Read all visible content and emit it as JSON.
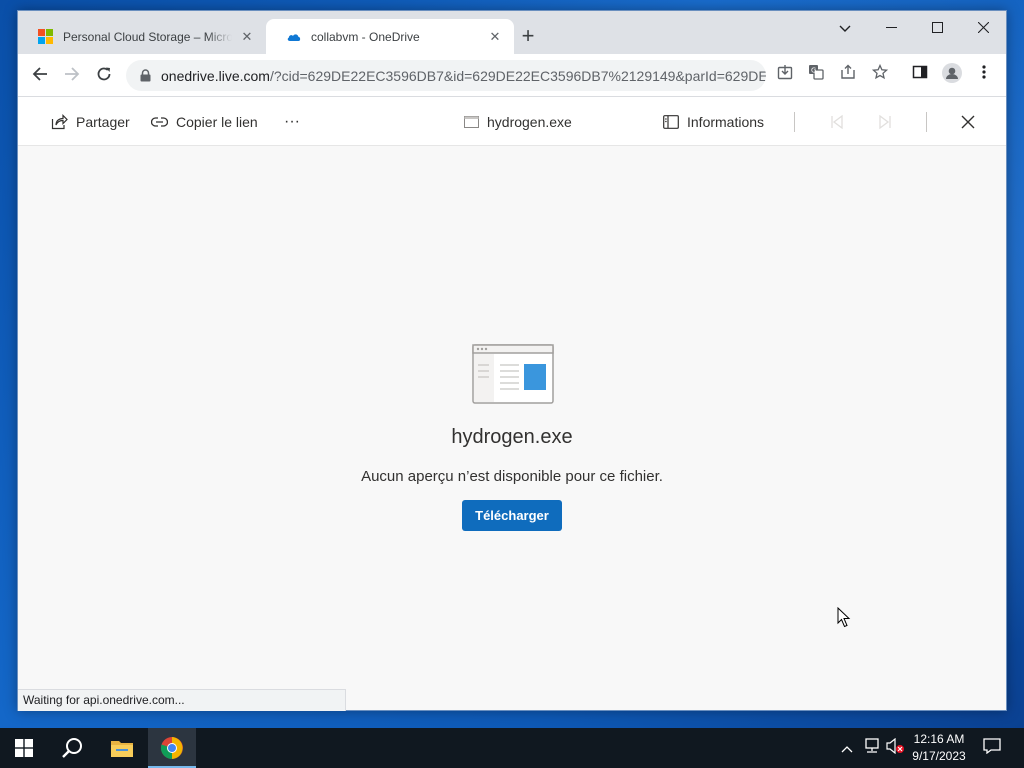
{
  "tabs": [
    {
      "title": "Personal Cloud Storage – Microsoft OneDrive",
      "active": false
    },
    {
      "title": "collabvm - OneDrive",
      "active": true
    }
  ],
  "omnibox": {
    "host": "onedrive.live.com",
    "rest": "/?cid=629DE22EC3596DB7&id=629DE22EC3596DB7%2129149&parId=629DE..."
  },
  "viewer": {
    "share_label": "Partager",
    "copy_link_label": "Copier le lien",
    "more_label": "···",
    "file_name": "hydrogen.exe",
    "info_label": "Informations"
  },
  "content": {
    "file_name": "hydrogen.exe",
    "message": "Aucun aperçu n’est disponible pour ce fichier.",
    "download_label": "Télécharger"
  },
  "status": "Waiting for api.onedrive.com...",
  "taskbar": {
    "time": "12:16 AM",
    "date": "9/17/2023"
  },
  "colors": {
    "onedrive_blue": "#0f6cbd",
    "desktop_blue": "#1467c8",
    "taskbar": "#101820"
  }
}
